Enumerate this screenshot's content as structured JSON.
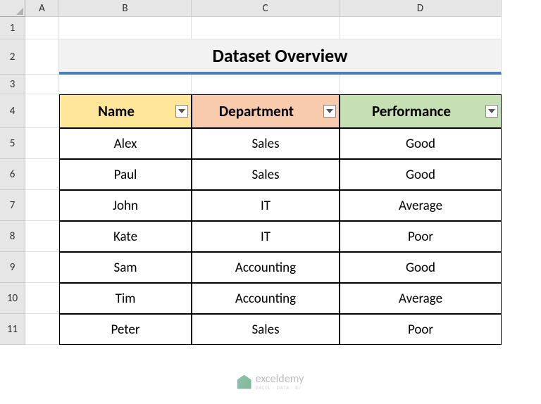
{
  "columns": [
    "A",
    "B",
    "C",
    "D"
  ],
  "rows": [
    "1",
    "2",
    "3",
    "4",
    "5",
    "6",
    "7",
    "8",
    "9",
    "10",
    "11"
  ],
  "title": "Dataset Overview",
  "headers": {
    "name": "Name",
    "department": "Department",
    "performance": "Performance"
  },
  "data": [
    {
      "name": "Alex",
      "department": "Sales",
      "performance": "Good"
    },
    {
      "name": "Paul",
      "department": "Sales",
      "performance": "Good"
    },
    {
      "name": "John",
      "department": "IT",
      "performance": "Average"
    },
    {
      "name": "Kate",
      "department": "IT",
      "performance": "Poor"
    },
    {
      "name": "Sam",
      "department": "Accounting",
      "performance": "Good"
    },
    {
      "name": "Tim",
      "department": "Accounting",
      "performance": "Average"
    },
    {
      "name": "Peter",
      "department": "Sales",
      "performance": "Poor"
    }
  ],
  "watermark": {
    "main": "exceldemy",
    "sub": "EXCEL · DATA · BI"
  },
  "chart_data": {
    "type": "table",
    "title": "Dataset Overview",
    "columns": [
      "Name",
      "Department",
      "Performance"
    ],
    "rows": [
      [
        "Alex",
        "Sales",
        "Good"
      ],
      [
        "Paul",
        "Sales",
        "Good"
      ],
      [
        "John",
        "IT",
        "Average"
      ],
      [
        "Kate",
        "IT",
        "Poor"
      ],
      [
        "Sam",
        "Accounting",
        "Good"
      ],
      [
        "Tim",
        "Accounting",
        "Average"
      ],
      [
        "Peter",
        "Sales",
        "Poor"
      ]
    ]
  }
}
